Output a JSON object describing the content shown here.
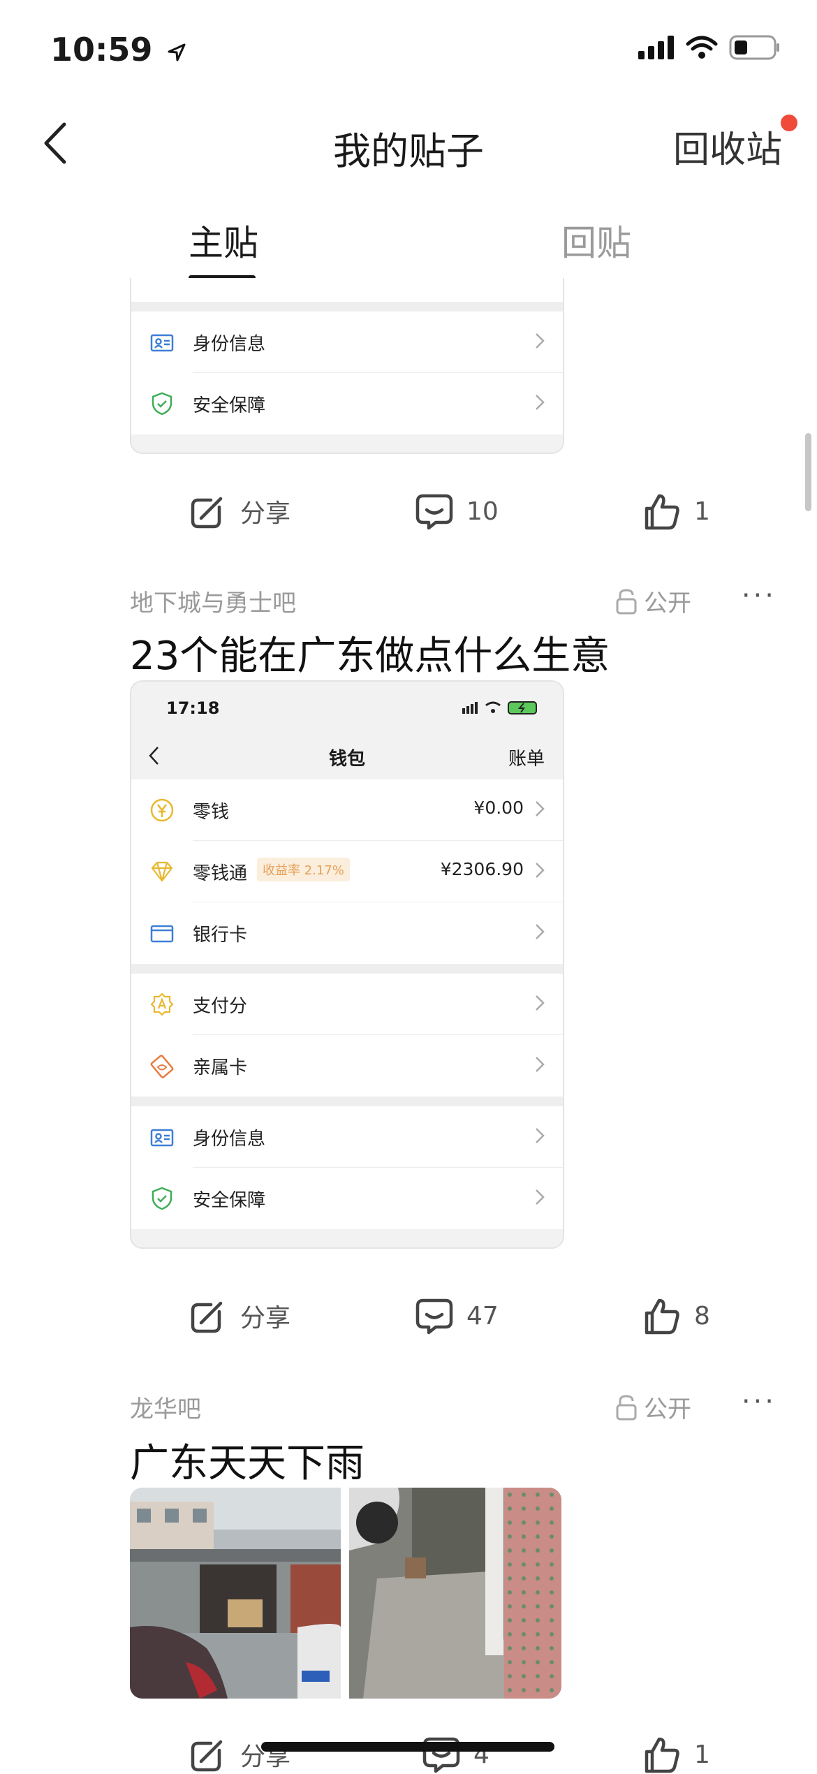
{
  "status_bar": {
    "time": "10:59"
  },
  "nav": {
    "title": "我的贴子",
    "recycle": "回收站"
  },
  "tabs": [
    {
      "label": "主贴"
    },
    {
      "label": "回贴"
    }
  ],
  "post1": {
    "partial_rows": [
      {
        "label": "身份信息"
      },
      {
        "label": "安全保障"
      }
    ],
    "actions": {
      "share": "分享",
      "comments": "10",
      "likes": "1"
    }
  },
  "post2": {
    "forum": "地下城与勇士吧",
    "privacy": "公开",
    "title": "23个能在广东做点什么生意",
    "screenshot": {
      "time": "17:18",
      "title": "钱包",
      "right": "账单",
      "rows": [
        {
          "label": "零钱",
          "value": "¥0.00"
        },
        {
          "label": "零钱通",
          "badge": "收益率 2.17%",
          "value": "¥2306.90"
        },
        {
          "label": "银行卡"
        },
        {
          "label": "支付分"
        },
        {
          "label": "亲属卡"
        },
        {
          "label": "身份信息"
        },
        {
          "label": "安全保障"
        }
      ]
    },
    "actions": {
      "share": "分享",
      "comments": "47",
      "likes": "8"
    }
  },
  "post3": {
    "forum": "龙华吧",
    "privacy": "公开",
    "title": "广东天天下雨",
    "actions": {
      "share": "分享",
      "comments": "4",
      "likes": "1"
    }
  },
  "colors": {
    "accent": "#f04a3a",
    "secondary_text": "#9a9a9a"
  }
}
